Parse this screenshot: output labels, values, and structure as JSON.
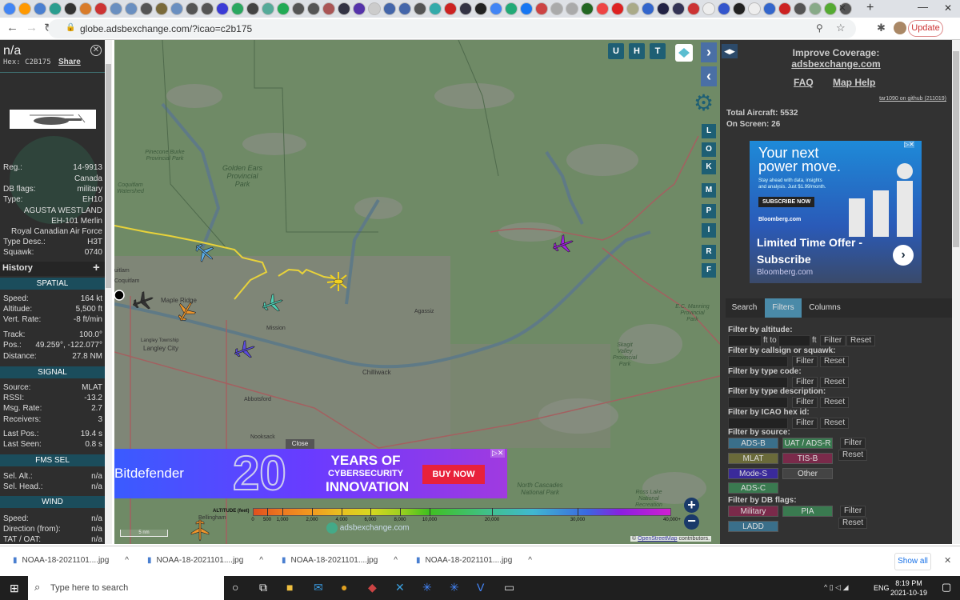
{
  "browser": {
    "url": "globe.adsbexchange.com/?icao=c2b175",
    "update_label": "Update",
    "bookmark_colors": [
      "#4285f4",
      "#f90",
      "#4a7fd0",
      "#2a9d8f",
      "#333",
      "#d87b2a",
      "#c33",
      "#6a8fc0",
      "#6a8fc0",
      "#555",
      "#7a6a3a",
      "#6a8fc0",
      "#555",
      "#555",
      "#3b3bd6",
      "#2aa760",
      "#444",
      "#5a9",
      "#2a5",
      "#555",
      "#555",
      "#a55",
      "#334",
      "#5533aa",
      "#ccc",
      "#4466aa",
      "#4466aa",
      "#555",
      "#3aa",
      "#c22",
      "#334",
      "#222",
      "#4285f4",
      "#2a7",
      "#1877f2",
      "#c44",
      "#aaa",
      "#aaa",
      "#262",
      "#e44",
      "#d22",
      "#aa8",
      "#3366cc",
      "#224",
      "#335",
      "#c33",
      "#eee",
      "#3355cc",
      "#222",
      "#eee",
      "#3366cc",
      "#c22",
      "#555",
      "#8a8",
      "#5a3",
      "#555"
    ],
    "new_tab": "+"
  },
  "aircraft": {
    "title": "n/a",
    "hex_label": "Hex:",
    "hex": "C2B175",
    "share": "Share",
    "reg_label": "Reg.:",
    "reg": "14-9913",
    "country": "Canada",
    "dbflags_label": "DB flags:",
    "dbflags": "military",
    "type_label": "Type:",
    "type": "EH10",
    "type_name": "AGUSTA WESTLAND EH-101 Merlin",
    "operator": "Royal Canadian Air Force",
    "typedesc_label": "Type Desc.:",
    "typedesc": "H3T",
    "squawk_label": "Squawk:",
    "squawk": "0740",
    "history": "History",
    "spatial": "SPATIAL",
    "speed_label": "Speed:",
    "speed": "164 kt",
    "altitude_label": "Altitude:",
    "altitude": "5,500 ft",
    "vrate_label": "Vert. Rate:",
    "vrate": "-8 ft/min",
    "track_label": "Track:",
    "track": "100.0°",
    "pos_label": "Pos.:",
    "pos": "49.259°, -122.077°",
    "distance_label": "Distance:",
    "distance": "27.8 NM",
    "signal": "SIGNAL",
    "source_label": "Source:",
    "source": "MLAT",
    "rssi_label": "RSSI:",
    "rssi": "-13.2",
    "msgrate_label": "Msg. Rate:",
    "msgrate": "2.7",
    "receivers_label": "Receivers:",
    "receivers": "3",
    "lastpos_label": "Last Pos.:",
    "lastpos": "19.4 s",
    "lastseen_label": "Last Seen:",
    "lastseen": "0.8 s",
    "fms": "FMS SEL",
    "selalt_label": "Sel. Alt.:",
    "selalt": "n/a",
    "selhead_label": "Sel. Head.:",
    "selhead": "n/a",
    "wind": "WIND",
    "wspeed_label": "Speed:",
    "wspeed": "n/a",
    "wdir_label": "Direction (from):",
    "wdir": "n/a",
    "tat_label": "TAT / OAT:",
    "tat": "n/a"
  },
  "map": {
    "labels": {
      "pinecone": "Pinecone Burke Provincial Park",
      "golden": "Golden Ears Provincial Park",
      "coqw": "Coquitlam Watershed",
      "coquitlam": "Coquitlam",
      "uitlam": "uitlam",
      "maple": "Maple Ridge",
      "mission": "Mission",
      "chilliwack": "Chilliwack",
      "langleyt": "Langley Township",
      "langley": "Langley City",
      "abbotsford": "Abbotsford",
      "agassiz": "Agassiz",
      "manning": "E.C. Manning Provincial Park",
      "skagit": "Skagit Valley Provincial Park",
      "cascades": "North Cascades National Park",
      "ross": "Ross Lake National Recreation Area",
      "nooksack": "Nooksack",
      "bellingham": "Bellingham"
    },
    "top_buttons": [
      "U",
      "H",
      "T"
    ],
    "side_buttons": [
      "L",
      "O",
      "K",
      "M",
      "P",
      "I",
      "R",
      "F"
    ],
    "scale": "5 nm",
    "attribution_prefix": "©",
    "attribution_link": "OpenStreetMap",
    "attribution_suffix": "contributors.",
    "watermark": "adsbexchange.com",
    "legend": {
      "title": "ALTITUDE (feet)",
      "ticks": [
        "0",
        "500",
        "1,000",
        "2,000",
        "4,000",
        "6,000",
        "8,000",
        "10,000",
        "20,000",
        "30,000",
        "40,000+"
      ]
    },
    "ad": {
      "close": "Close",
      "brand": "Bitdefender",
      "number": "20",
      "line1": "YEARS OF",
      "line2": "CYBERSECURITY",
      "line3": "INNOVATION",
      "cta": "BUY NOW"
    }
  },
  "right": {
    "improve": "Improve Coverage:",
    "site": "adsbexchange.com",
    "faq": "FAQ",
    "maphelp": "Map Help",
    "version": "tar1090 on github (211019)",
    "total": "Total Aircraft: 5532",
    "onscreen": "On Screen: 26",
    "ad": {
      "h1": "Your next",
      "h2": "power move.",
      "sub1": "Stay ahead with data, insights",
      "sub2": "and analysis. Just $1.99/month.",
      "cta": "SUBSCRIBE NOW",
      "brand": "Bloomberg.com",
      "offer1": "Limited Time Offer -",
      "offer2": "Subscribe",
      "footer": "Bloomberg.com"
    },
    "tabs": [
      "Search",
      "Filters",
      "Columns"
    ],
    "filters": {
      "altitude": "Filter by altitude:",
      "ft_to": "ft to",
      "ft": "ft",
      "callsign": "Filter by callsign or squawk:",
      "typecode": "Filter by type code:",
      "typedesc": "Filter by type description:",
      "icao": "Filter by ICAO hex id:",
      "source": "Filter by source:",
      "dbflags": "Filter by DB flags:",
      "filter": "Filter",
      "reset": "Reset",
      "sources": [
        "ADS-B",
        "UAT / ADS-R",
        "MLAT",
        "TIS-B",
        "Mode-S",
        "Other",
        "ADS-C"
      ],
      "flags": [
        "Military",
        "PIA",
        "LADD"
      ]
    }
  },
  "downloads": {
    "files": [
      "NOAA-18-2021101....jpg",
      "NOAA-18-2021101....jpg",
      "NOAA-18-2021101....jpg",
      "NOAA-18-2021101....jpg"
    ],
    "show_all": "Show all"
  },
  "taskbar": {
    "search_placeholder": "Type here to search",
    "lang": "ENG",
    "time": "8:19 PM",
    "date": "2021-10-19"
  }
}
